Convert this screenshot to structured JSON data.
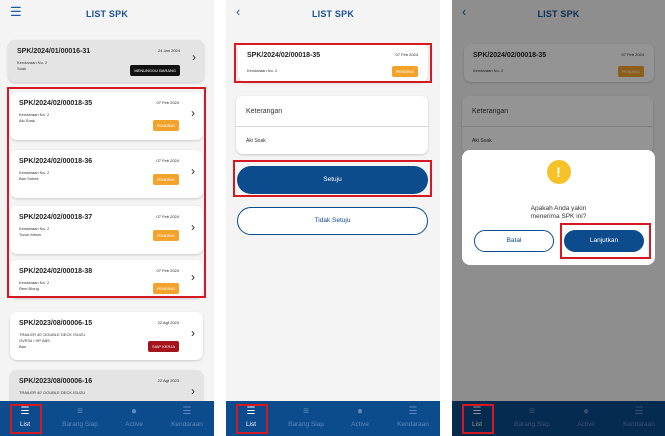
{
  "screen1": {
    "title": "LIST SPK",
    "menu_icon": "hamburger-icon",
    "cards": [
      {
        "code": "SPK/2024/01/00016-31",
        "date": "24 Jan 2024",
        "line1": "Kendaraan No. 2",
        "line2": "Soak",
        "line3": "",
        "status": "MENUNGGU BARANG",
        "status_color": "#111111"
      },
      {
        "code": "SPK/2024/02/00018-35",
        "date": "07 Feb 2024",
        "line1": "Kendaraan No. 2",
        "line2": "Aki Soak",
        "line3": "",
        "status": "PENDING",
        "status_color": "#f3a32b"
      },
      {
        "code": "SPK/2024/02/00018-36",
        "date": "07 Feb 2024",
        "line1": "Kendaraan No. 2",
        "line2": "Ban Sobek",
        "line3": "",
        "status": "PENDING",
        "status_color": "#f3a32b"
      },
      {
        "code": "SPK/2024/02/00018-37",
        "date": "07 Feb 2024",
        "line1": "Kendaraan No. 2",
        "line2": "Turun Mesin",
        "line3": "",
        "status": "PENDING",
        "status_color": "#f3a32b"
      },
      {
        "code": "SPK/2024/02/00018-38",
        "date": "07 Feb 2024",
        "line1": "Kendaraan No. 2",
        "line2": "Rem Blong",
        "line3": "",
        "status": "PENDING",
        "status_color": "#f3a32b"
      },
      {
        "code": "SPK/2023/08/00006-15",
        "date": "22 Agt 2023",
        "line1": "TRAILER 40' DOUBLE DECK ISUZU",
        "line2": "GVR34 / HP ABS",
        "line3": "Ban",
        "status": "SIAP KERJA",
        "status_color": "#a4141c"
      },
      {
        "code": "SPK/2023/08/00006-16",
        "date": "22 Agt 2023",
        "line1": "TRAILER 40' DOUBLE DECK ISUZU",
        "line2": "",
        "line3": "",
        "status": "",
        "status_color": "#a4141c"
      }
    ]
  },
  "screen2": {
    "title": "LIST SPK",
    "back_icon": "chevron-left-icon",
    "card": {
      "code": "SPK/2024/02/00018-35",
      "date": "07 Feb 2024",
      "line1": "Kendaraan No. 2",
      "status": "PENDING"
    },
    "keterangan_label": "Keterangan",
    "keterangan_value": "Aki Soak",
    "approve_label": "Setuju",
    "reject_label": "Tidak Setuju"
  },
  "screen3": {
    "title": "LIST SPK",
    "card": {
      "code": "SPK/2024/02/00018-35",
      "date": "07 Feb 2024",
      "line1": "Kendaraan No. 2",
      "status": "PENDING"
    },
    "keterangan_label": "Keterangan",
    "keterangan_value": "Aki Soak",
    "dialog": {
      "icon": "warning-icon",
      "message_line1": "Apakah Anda yakin",
      "message_line2": "menerima SPK ini?",
      "cancel_label": "Batal",
      "confirm_label": "Lanjutkan"
    }
  },
  "nav": [
    {
      "label": "List",
      "icon": "list-icon",
      "active": true
    },
    {
      "label": "Barang Siap",
      "icon": "checklist-icon",
      "active": false
    },
    {
      "label": "Active",
      "icon": "person-icon",
      "active": false
    },
    {
      "label": "Kendaraan",
      "icon": "list-icon",
      "active": false
    }
  ],
  "colors": {
    "primary": "#0c4b8c",
    "pending": "#f3a32b",
    "highlight": "#d41923"
  }
}
